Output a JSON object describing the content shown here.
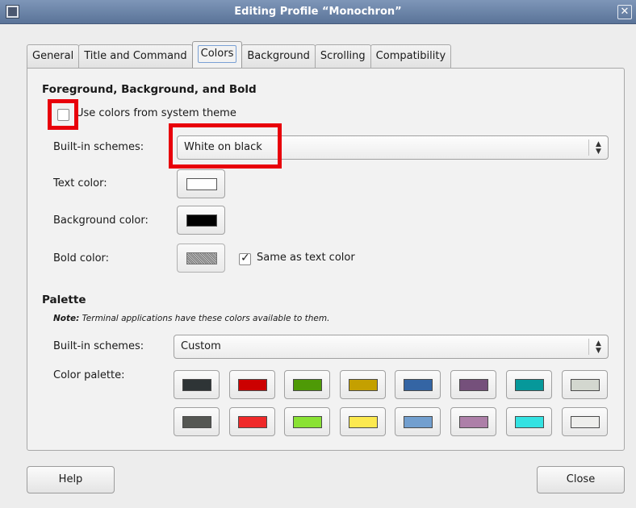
{
  "window": {
    "title": "Editing Profile “Monochron”"
  },
  "tabs": [
    {
      "label": "General"
    },
    {
      "label": "Title and Command"
    },
    {
      "label": "Colors"
    },
    {
      "label": "Background"
    },
    {
      "label": "Scrolling"
    },
    {
      "label": "Compatibility"
    }
  ],
  "active_tab": "Colors",
  "foreground": {
    "section_title": "Foreground, Background, and Bold",
    "use_system_theme_label": "Use colors from system theme",
    "use_system_theme_checked": false,
    "builtin_schemes_label": "Built-in schemes:",
    "builtin_schemes_value": "White on black",
    "text_color_label": "Text color:",
    "text_color": "#ffffff",
    "background_color_label": "Background color:",
    "background_color": "#000000",
    "bold_color_label": "Bold color:",
    "bold_color": "#8a8a8a",
    "same_as_text_label": "Same as text color",
    "same_as_text_checked": true
  },
  "palette": {
    "section_title": "Palette",
    "note_bold": "Note:",
    "note_text": " Terminal applications have these colors available to them.",
    "builtin_schemes_label": "Built-in schemes:",
    "builtin_schemes_value": "Custom",
    "color_palette_label": "Color palette:",
    "row1": [
      "#2e3436",
      "#cc0000",
      "#4e9a06",
      "#c4a000",
      "#3465a4",
      "#75507b",
      "#06989a",
      "#d3d7cf"
    ],
    "row2": [
      "#555753",
      "#ef2929",
      "#8ae234",
      "#fce94f",
      "#729fcf",
      "#ad7fa8",
      "#34e2e2",
      "#eeeeec"
    ]
  },
  "footer": {
    "help_label": "Help",
    "close_label": "Close"
  },
  "highlight_color": "#e8000b"
}
